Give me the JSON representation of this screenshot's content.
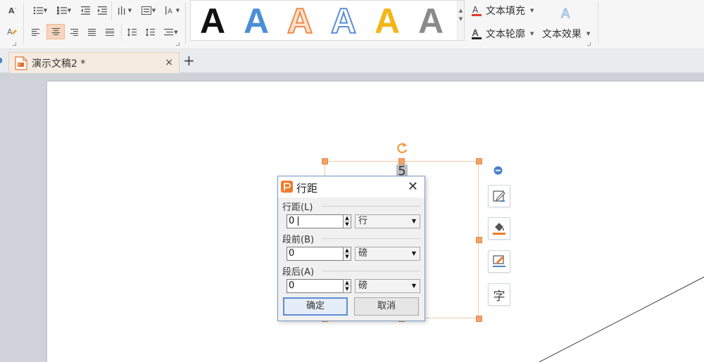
{
  "ribbon": {
    "font_size_label": "A",
    "wordart_styles": [
      {
        "glyph": "A",
        "style": "black-fill"
      },
      {
        "glyph": "A",
        "style": "blue-fill"
      },
      {
        "glyph": "A",
        "style": "orange-outline"
      },
      {
        "glyph": "A",
        "style": "blue-outline"
      },
      {
        "glyph": "A",
        "style": "gold-fill"
      },
      {
        "glyph": "A",
        "style": "gray-gradient"
      }
    ],
    "text_fill_label": "文本填充",
    "text_outline_label": "文本轮廓",
    "text_effect_label": "文本效果",
    "colors": {
      "text_fill_underline": "#e23b2e",
      "wordart_black": "#111111",
      "wordart_blue": "#4a8fd6",
      "wordart_orange": "#ef8a4a",
      "wordart_gold": "#f3b517",
      "wordart_gray": "#8a8a8a"
    }
  },
  "tabs": {
    "doc_title": "演示文稿2 *",
    "close_glyph": "×",
    "new_tab_glyph": "+"
  },
  "slide": {
    "textbox_content": "5"
  },
  "dialog": {
    "title": "行距",
    "close_glyph": "✕",
    "groups": [
      {
        "label": "行距(L)",
        "value": "0",
        "unit": "行"
      },
      {
        "label": "段前(B)",
        "value": "0",
        "unit": "磅"
      },
      {
        "label": "段后(A)",
        "value": "0",
        "unit": "磅"
      }
    ],
    "ok_label": "确定",
    "cancel_label": "取消",
    "accent": "#f07b2c"
  },
  "side_tools": {
    "font_tool_glyph": "字"
  }
}
